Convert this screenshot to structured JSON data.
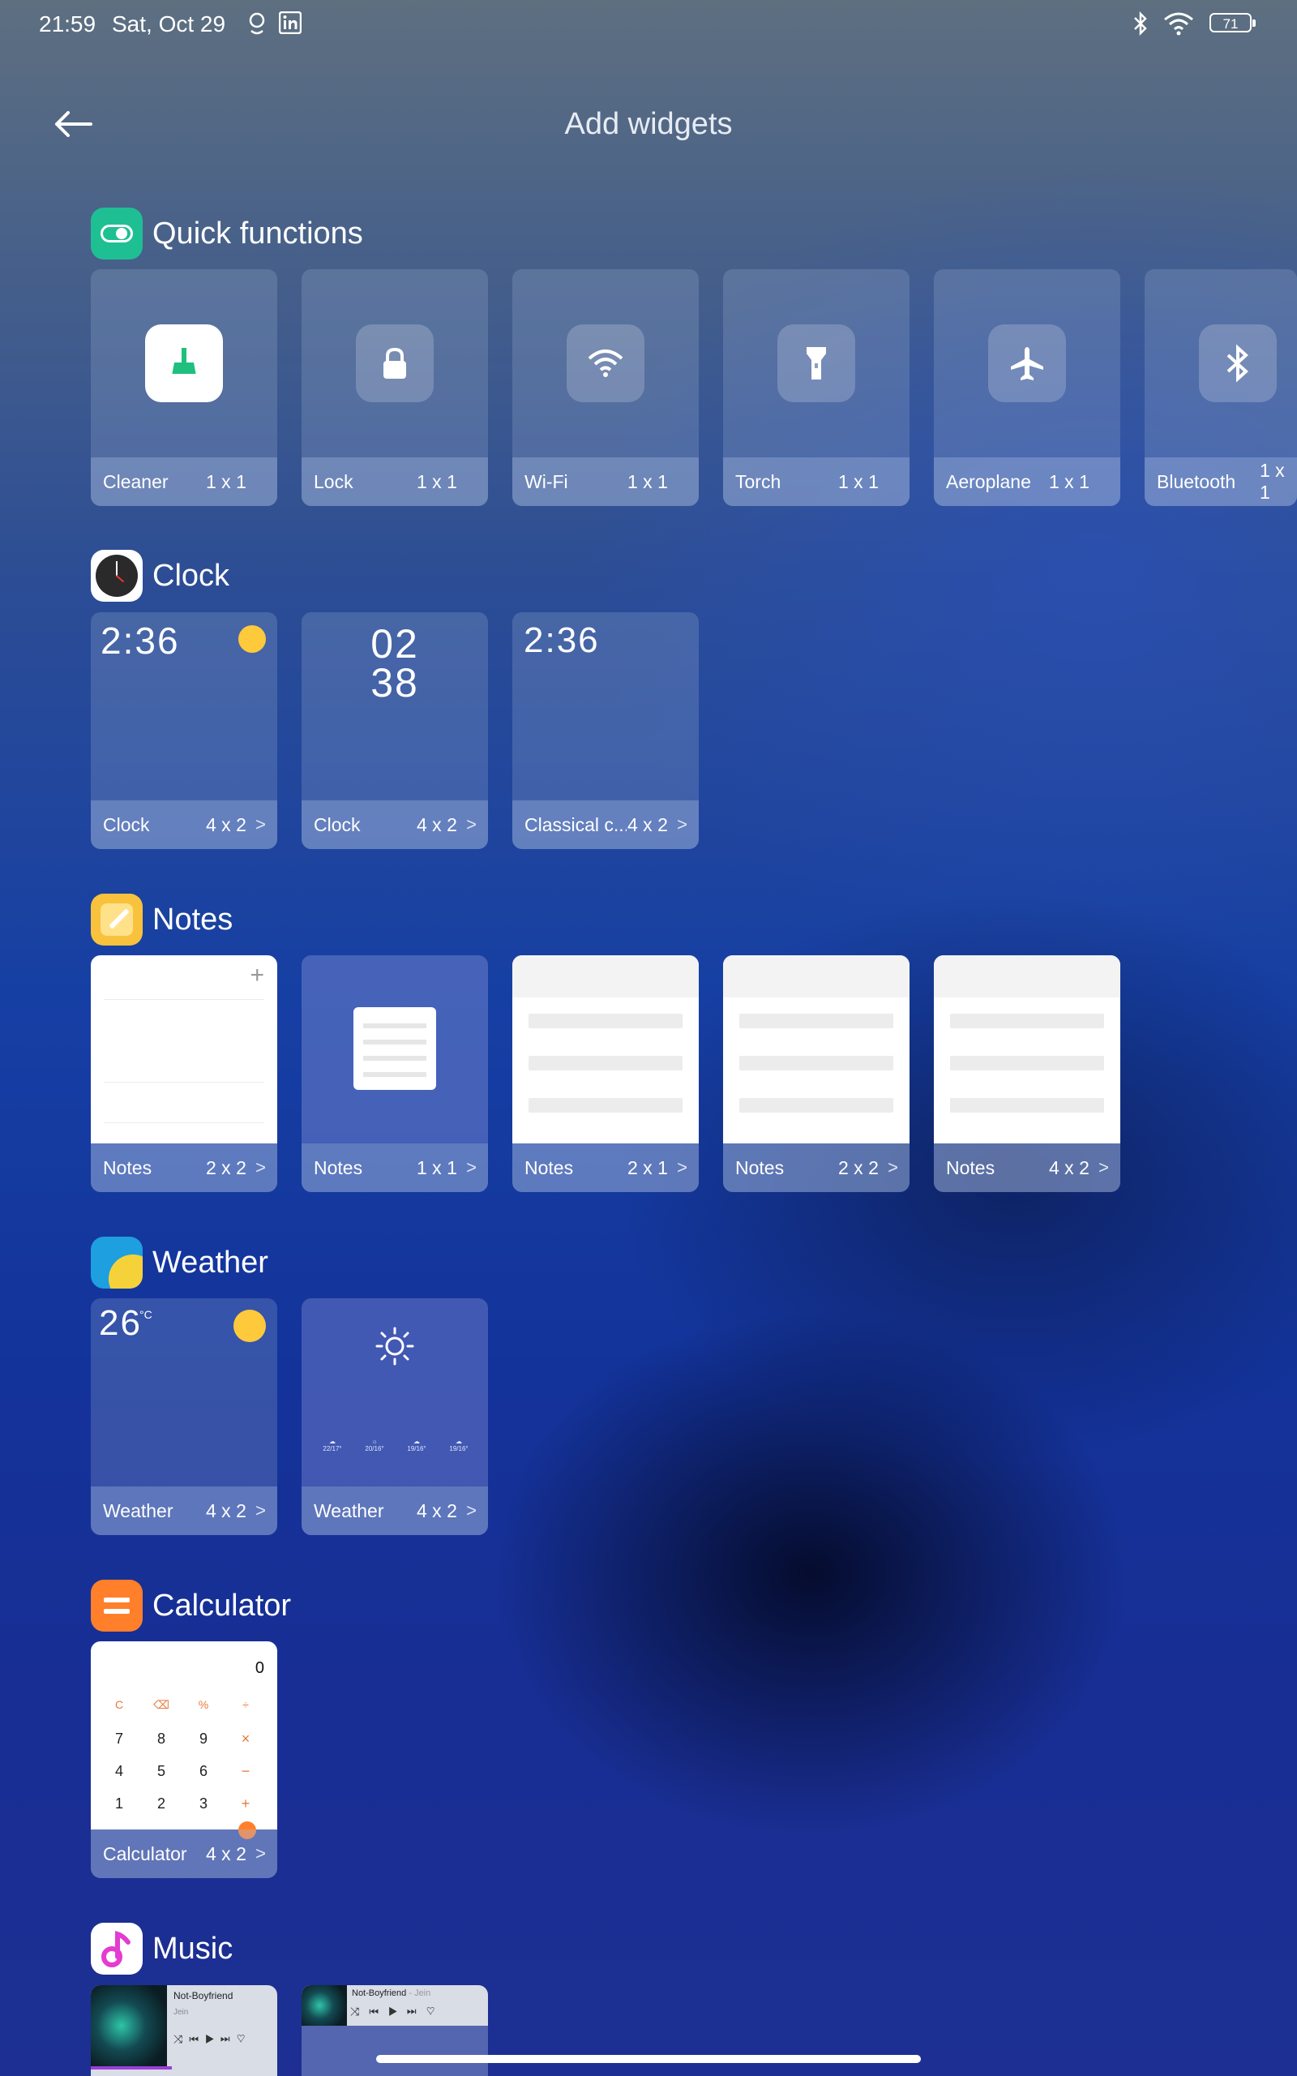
{
  "status_bar": {
    "time": "21:59",
    "date": "Sat, Oct 29",
    "battery": "71",
    "icons": [
      "location-icon",
      "linkedin-icon",
      "bluetooth-icon",
      "wifi-icon",
      "battery-icon"
    ]
  },
  "header": {
    "title": "Add widgets",
    "back_icon": "back-arrow-icon"
  },
  "sections": {
    "quick": {
      "title": "Quick functions",
      "cards": [
        {
          "name": "Cleaner",
          "size": "1 x 1",
          "icon": "broom-icon"
        },
        {
          "name": "Lock",
          "size": "1 x 1",
          "icon": "lock-icon"
        },
        {
          "name": "Wi-Fi",
          "size": "1 x 1",
          "icon": "wifi-icon"
        },
        {
          "name": "Torch",
          "size": "1 x 1",
          "icon": "torch-icon"
        },
        {
          "name": "Aeroplane",
          "size": "1 x 1",
          "icon": "airplane-icon"
        },
        {
          "name": "Bluetooth",
          "size": "1 x 1",
          "icon": "bluetooth-icon"
        }
      ]
    },
    "clock": {
      "title": "Clock",
      "cards": [
        {
          "name": "Clock",
          "size": "4 x 2",
          "display": "2:36"
        },
        {
          "name": "Clock",
          "size": "4 x 2",
          "hours": "02",
          "minutes": "38"
        },
        {
          "name": "Classical c...",
          "size": "4 x 2",
          "display": "2:36"
        }
      ]
    },
    "notes": {
      "title": "Notes",
      "cards": [
        {
          "name": "Notes",
          "size": "2 x 2"
        },
        {
          "name": "Notes",
          "size": "1 x 1"
        },
        {
          "name": "Notes",
          "size": "2 x 1"
        },
        {
          "name": "Notes",
          "size": "2 x 2"
        },
        {
          "name": "Notes",
          "size": "4 x 2"
        }
      ]
    },
    "weather": {
      "title": "Weather",
      "cards": [
        {
          "name": "Weather",
          "size": "4 x 2",
          "temp": "26",
          "unit": "°C"
        },
        {
          "name": "Weather",
          "size": "4 x 2",
          "forecast": [
            "22/17°",
            "20/16°",
            "19/16°",
            "19/16°"
          ]
        }
      ]
    },
    "calculator": {
      "title": "Calculator",
      "cards": [
        {
          "name": "Calculator",
          "size": "4 x 2",
          "display": "0",
          "keys": [
            [
              "C",
              "⌫",
              "%",
              "÷"
            ],
            [
              "7",
              "8",
              "9",
              "×"
            ],
            [
              "4",
              "5",
              "6",
              "−"
            ],
            [
              "1",
              "2",
              "3",
              "+"
            ]
          ]
        }
      ]
    },
    "music": {
      "title": "Music",
      "cards": [
        {
          "song": "Not-Boyfriend",
          "artist": "Jein"
        },
        {
          "song": "Not-Boyfriend",
          "artist": "Jein"
        }
      ]
    }
  },
  "colors": {
    "cleaner_green": "#1fc07d",
    "notes_yellow": "#f8c23c",
    "calculator_orange": "#ff7f2a",
    "music_pink": "#e43bd0",
    "sun_yellow": "#ffc93c"
  }
}
